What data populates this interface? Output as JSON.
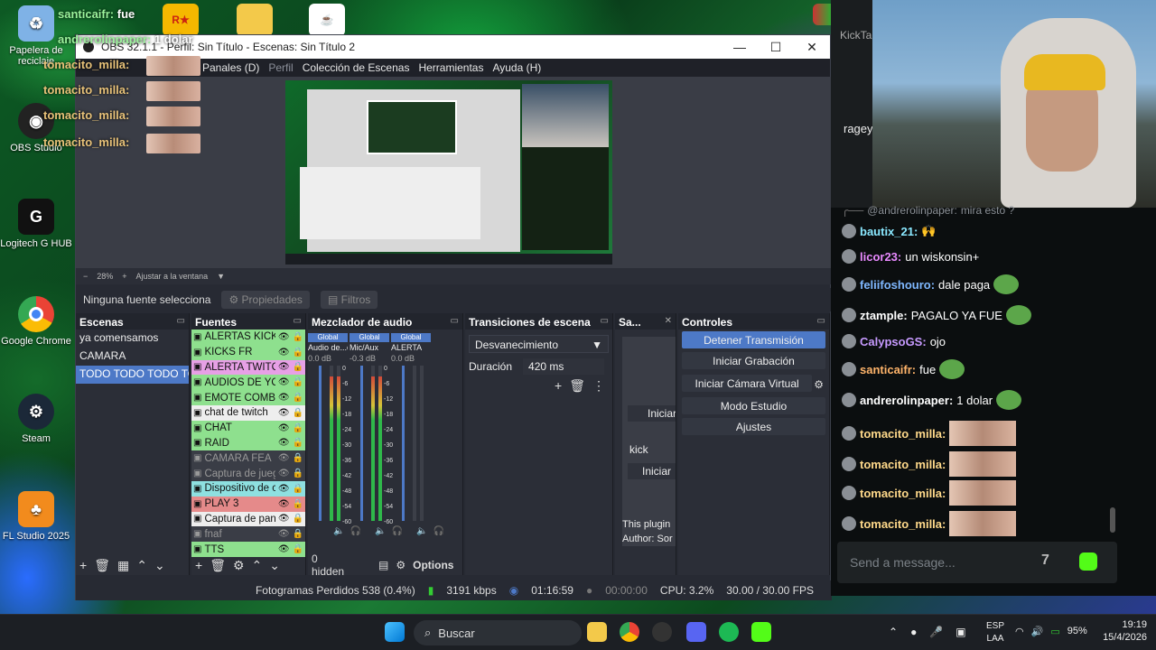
{
  "desktop": {
    "icons": [
      {
        "label": "Papelera de reciclaje",
        "name": "recycle-bin-icon"
      },
      {
        "label": "OBS Studio",
        "name": "obs-studio-icon"
      },
      {
        "label": "Logitech G HUB",
        "name": "logitech-g-hub-icon"
      },
      {
        "label": "Google Chrome",
        "name": "google-chrome-icon"
      },
      {
        "label": "Steam",
        "name": "steam-icon"
      },
      {
        "label": "FL Studio 2025",
        "name": "fl-studio-icon"
      }
    ],
    "overlay_chat": [
      {
        "user": "santicaifr:",
        "text": "fue"
      },
      {
        "user": "andrerolinpaper:",
        "text": "1 dolar"
      },
      {
        "user": "tomacito_milla:",
        "text": ""
      },
      {
        "user": "tomacito_milla:",
        "text": ""
      },
      {
        "user": "tomacito_milla:",
        "text": ""
      },
      {
        "user": "tomacito_milla:",
        "text": ""
      }
    ]
  },
  "obs": {
    "title": "OBS 32.1.1 - Perfil: Sin Título - Escenas: Sin Título 2",
    "menu": [
      "Panales (D)",
      "Perfil",
      "Colección de Escenas",
      "Herramientas",
      "Ayuda (H)"
    ],
    "zoom": {
      "minus": "−",
      "value": "28%",
      "plus": "+",
      "fit": "Ajustar a la ventana"
    },
    "source_bar": {
      "none_selected": "Ninguna fuente selecciona",
      "properties": "Propiedades",
      "filters": "Filtros"
    },
    "scenes": {
      "title": "Escenas",
      "items": [
        "ya comensamos",
        "CAMARA",
        "TODO TODO TODO TODO"
      ],
      "selected": 2
    },
    "sources": {
      "title": "Fuentes",
      "items": [
        {
          "name": "ALERTAS KICK",
          "color": "#8ee08e"
        },
        {
          "name": "KICKS FR",
          "color": "#8ee08e"
        },
        {
          "name": "ALERTA TWITCH",
          "color": "#e7a0e6"
        },
        {
          "name": "AUDIOS DE YOUTUBE",
          "color": "#8ee08e"
        },
        {
          "name": "EMOTE COMBO",
          "color": "#8ee08e"
        },
        {
          "name": "chat de twitch",
          "color": "#eeeeee"
        },
        {
          "name": "CHAT",
          "color": "#8ee08e"
        },
        {
          "name": "RAID",
          "color": "#8ee08e"
        },
        {
          "name": "CAMARA FEA",
          "color": "#3a3d46"
        },
        {
          "name": "Captura de juego",
          "color": "#3a3d46"
        },
        {
          "name": "Dispositivo de captura",
          "color": "#8ee0e0"
        },
        {
          "name": "PLAY 3",
          "color": "#e58a8a"
        },
        {
          "name": "Captura de pantalla",
          "color": "#eeeeee"
        },
        {
          "name": "fnaf",
          "color": "#3a3d46"
        },
        {
          "name": "TTS",
          "color": "#8ee08e"
        }
      ]
    },
    "mixer": {
      "title": "Mezclador de audio",
      "channels": [
        {
          "tag": "Global",
          "name": "Audio de...critorio",
          "db": "0.0 dB",
          "level": 0.93
        },
        {
          "tag": "Global",
          "name": "Mic/Aux",
          "db": "-0.3 dB",
          "level": 0.93
        },
        {
          "tag": "Global",
          "name": "ALERTA",
          "db": "0.0 dB",
          "level": 0.0
        }
      ],
      "ticks": [
        "0",
        "-6",
        "-12",
        "-18",
        "-24",
        "-30",
        "-36",
        "-42",
        "-48",
        "-54",
        "-60"
      ],
      "hidden": "0 hidden",
      "options": "Options"
    },
    "transitions": {
      "title": "Transiciones de escena",
      "type": "Desvanecimiento",
      "duration_label": "Duración",
      "duration": "420 ms"
    },
    "plugin": {
      "title": "Sa...",
      "start1": "Iniciar",
      "kick": "kick",
      "start2": "Iniciar",
      "info": "This plugin",
      "author": "Author: Sor"
    },
    "controls": {
      "title": "Controles",
      "buttons": [
        "Detener Transmisión",
        "Iniciar Grabación",
        "Iniciar Cámara Virtual",
        "Modo Estudio",
        "Ajustes"
      ]
    },
    "status": {
      "dropped": "Fotogramas Perdidos 538 (0.4%)",
      "kbps": "3191 kbps",
      "stream_time": "01:16:59",
      "rec_time": "00:00:00",
      "cpu": "CPU: 3.2%",
      "fps": "30.00 / 30.00 FPS"
    }
  },
  "chat": {
    "header_partial": "KickTa",
    "tab_partial": "ragey",
    "messages": [
      {
        "user": "@andrerolinpaper:",
        "text": "mira esto ?",
        "color": "#8a8f95",
        "reply": true
      },
      {
        "user": "bautix_21:",
        "text": "",
        "color": "#8ae8ff"
      },
      {
        "user": "licor23:",
        "text": "un wiskonsin+",
        "color": "#e98aff"
      },
      {
        "user": "feliifoshouro:",
        "text": "dale paga",
        "color": "#7fb8ff"
      },
      {
        "user": "ztample:",
        "text": "PAGALO YA FUE",
        "color": "#ffffff"
      },
      {
        "user": "CalypsoGS:",
        "text": "ojo",
        "color": "#c79aff"
      },
      {
        "user": "santicaifr:",
        "text": "fue",
        "color": "#ffb46a"
      },
      {
        "user": "andrerolinpaper:",
        "text": "1 dolar",
        "color": "#ffffff"
      },
      {
        "user": "tomacito_milla:",
        "text": "",
        "color": "#ffd98a"
      },
      {
        "user": "tomacito_milla:",
        "text": "",
        "color": "#ffd98a"
      },
      {
        "user": "tomacito_milla:",
        "text": "",
        "color": "#ffd98a"
      },
      {
        "user": "tomacito_milla:",
        "text": "",
        "color": "#ffd98a"
      }
    ],
    "send_placeholder": "Send a message..."
  },
  "taskbar": {
    "search": "Buscar",
    "lang1": "ESP",
    "lang2": "LAA",
    "battery": "95%",
    "time": "19:19",
    "date": "15/4/2026"
  }
}
